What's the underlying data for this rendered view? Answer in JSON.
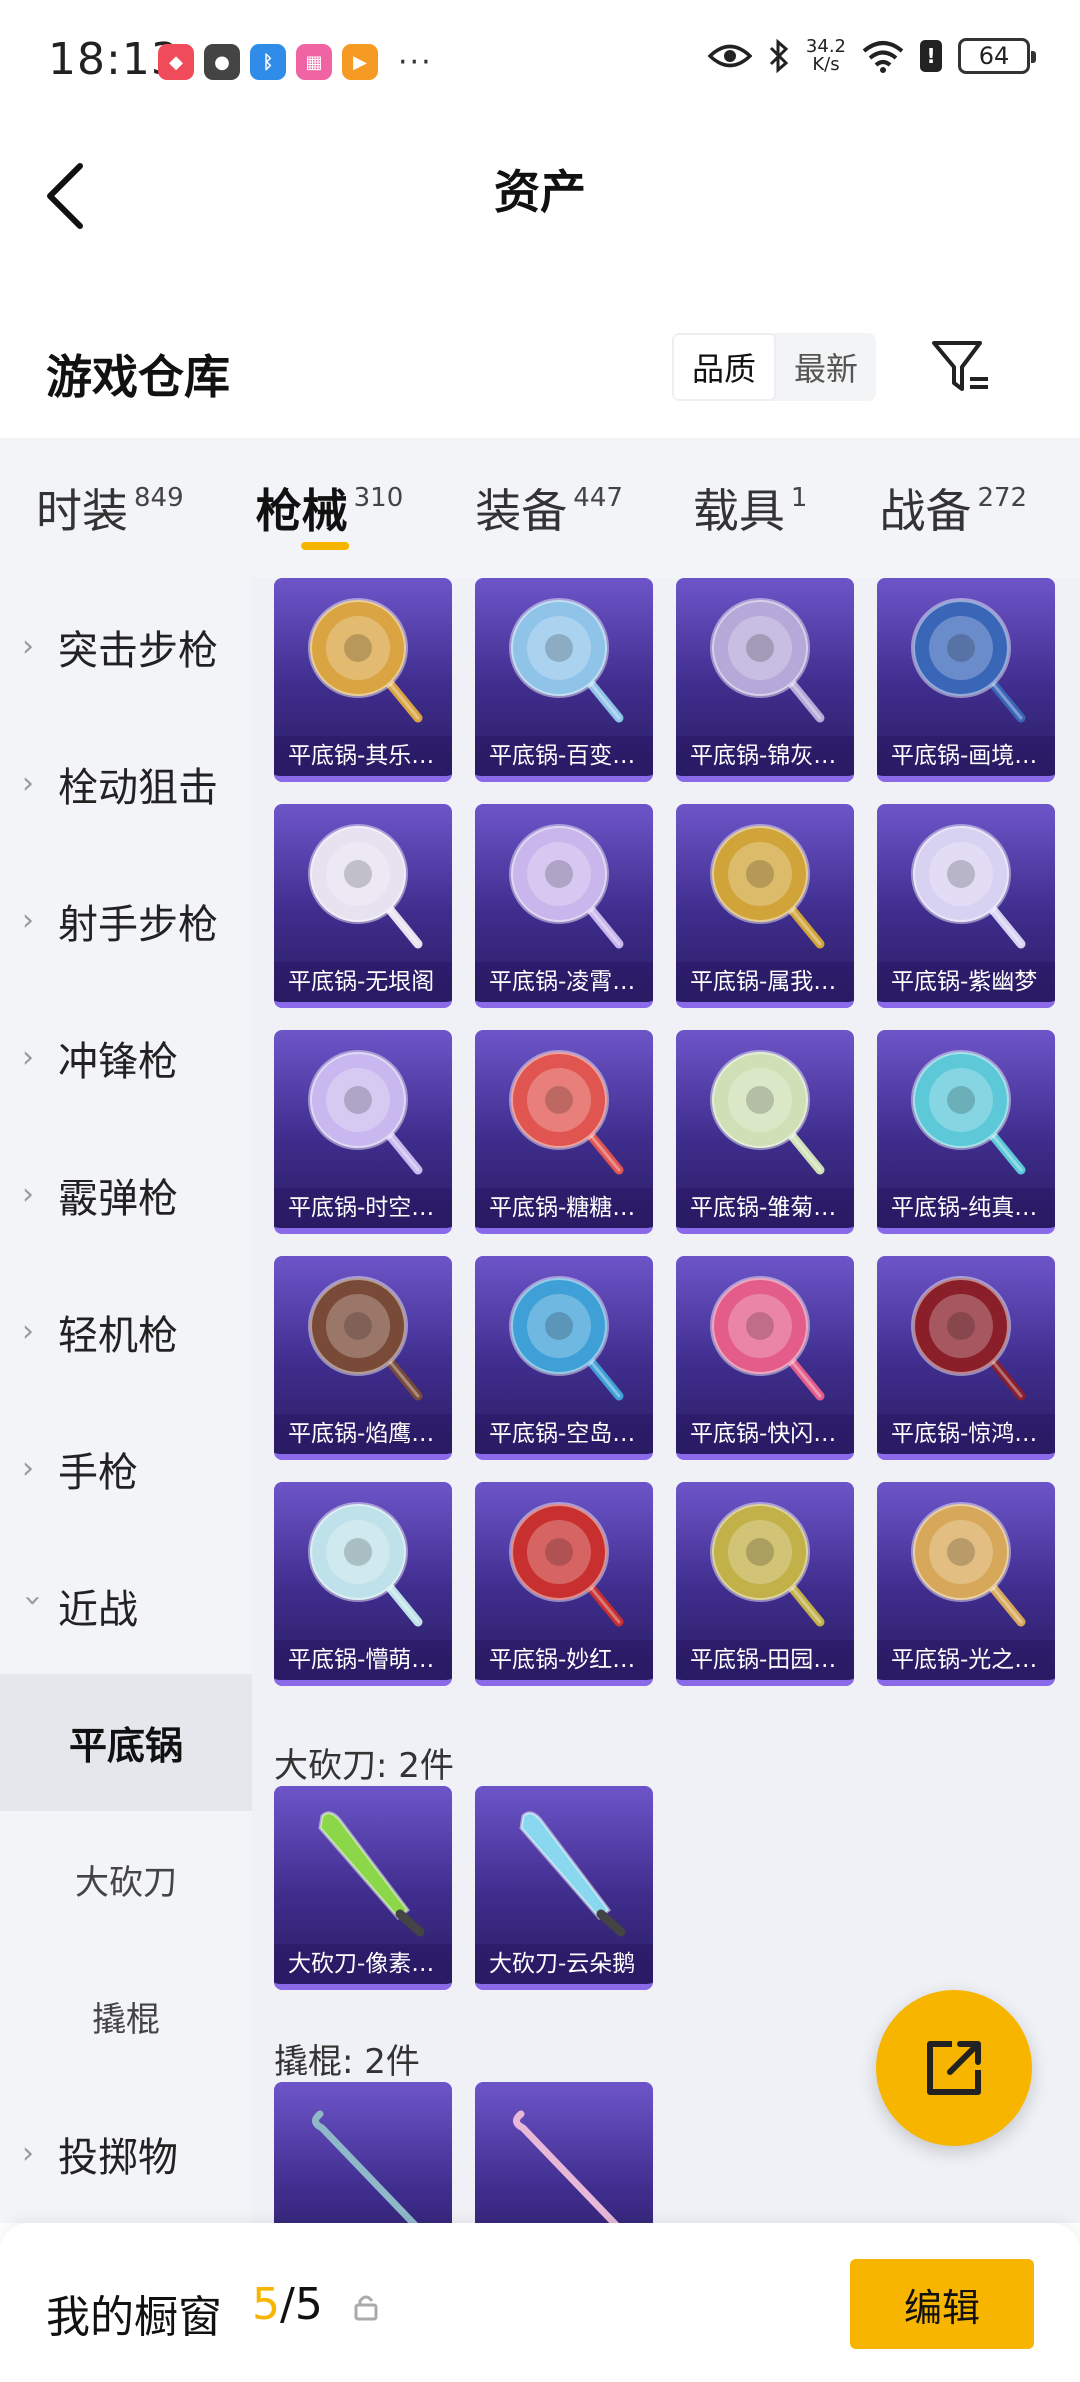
{
  "status_bar": {
    "time": "18:13",
    "net_speed_value": "34.2",
    "net_speed_unit": "K/s",
    "battery": "64",
    "more_dots": "···"
  },
  "header": {
    "title": "资产"
  },
  "section": {
    "title": "游戏仓库",
    "sort_options": [
      "品质",
      "最新"
    ],
    "active_sort": "品质"
  },
  "tabs": [
    {
      "label": "时装",
      "count": "849"
    },
    {
      "label": "枪械",
      "count": "310",
      "active": true
    },
    {
      "label": "装备",
      "count": "447"
    },
    {
      "label": "载具",
      "count": "1"
    },
    {
      "label": "战备",
      "count": "272"
    }
  ],
  "sidebar": {
    "items": [
      {
        "label": "突击步枪"
      },
      {
        "label": "栓动狙击"
      },
      {
        "label": "射手步枪"
      },
      {
        "label": "冲锋枪"
      },
      {
        "label": "霰弹枪"
      },
      {
        "label": "轻机枪"
      },
      {
        "label": "手枪"
      },
      {
        "label": "近战"
      }
    ],
    "sub_items": [
      {
        "label": "平底锅",
        "active": true
      },
      {
        "label": "大砍刀"
      },
      {
        "label": "撬棍"
      }
    ],
    "last_item": {
      "label": "投掷物"
    }
  },
  "groups": {
    "pan": {
      "items": [
        {
          "name": "平底锅-其乐…",
          "color": "#d9a441"
        },
        {
          "name": "平底锅-百变…",
          "color": "#8fc3e8"
        },
        {
          "name": "平底锅-锦灰…",
          "color": "#b6a8d8"
        },
        {
          "name": "平底锅-画境…",
          "color": "#3a66b8"
        },
        {
          "name": "平底锅-无垠阁",
          "color": "#e6e2f0"
        },
        {
          "name": "平底锅-凌霄…",
          "color": "#c9b6ec"
        },
        {
          "name": "平底锅-属我…",
          "color": "#d1a43a"
        },
        {
          "name": "平底锅-紫幽梦",
          "color": "#d8d2f2"
        },
        {
          "name": "平底锅-时空…",
          "color": "#c8b8ef"
        },
        {
          "name": "平底锅-糖糖…",
          "color": "#e0554f"
        },
        {
          "name": "平底锅-雏菊…",
          "color": "#cfe0b6"
        },
        {
          "name": "平底锅-纯真…",
          "color": "#5cc8d8"
        },
        {
          "name": "平底锅-焰鹰…",
          "color": "#7a4a38"
        },
        {
          "name": "平底锅-空岛…",
          "color": "#3fa0d8"
        },
        {
          "name": "平底锅-快闪…",
          "color": "#e35c8a"
        },
        {
          "name": "平底锅-惊鸿…",
          "color": "#8a1f2a"
        },
        {
          "name": "平底锅-懵萌…",
          "color": "#bfe2ea"
        },
        {
          "name": "平底锅-妙红…",
          "color": "#c8302f"
        },
        {
          "name": "平底锅-田园…",
          "color": "#c2b048"
        },
        {
          "name": "平底锅-光之…",
          "color": "#d8a85a"
        }
      ]
    },
    "machete": {
      "title": "大砍刀: 2件",
      "items": [
        {
          "name": "大砍刀-像素…",
          "color": "#8cd64a"
        },
        {
          "name": "大砍刀-云朵鹅",
          "color": "#8ad8f0"
        }
      ]
    },
    "crowbar": {
      "title": "撬棍: 2件",
      "items": [
        {
          "name": "",
          "color": "#8fb8c8"
        },
        {
          "name": "",
          "color": "#e8b8d8"
        }
      ]
    }
  },
  "bottom": {
    "label": "我的橱窗",
    "current": "5",
    "total": "/5",
    "edit_label": "编辑"
  },
  "colors": {
    "accent": "#f7b500",
    "card_top": "#6d55c9",
    "card_bottom": "#2a1e63"
  }
}
